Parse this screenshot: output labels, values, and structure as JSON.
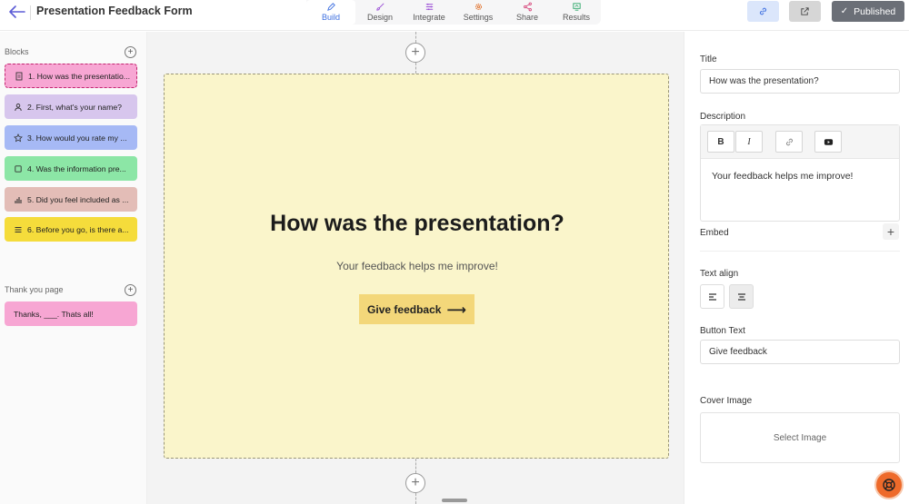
{
  "header": {
    "title": "Presentation Feedback Form",
    "tabs": [
      {
        "label": "Build",
        "icon": "pencil-icon",
        "color": "#3d6fe0"
      },
      {
        "label": "Design",
        "icon": "brush-icon",
        "color": "#9b4fd6"
      },
      {
        "label": "Integrate",
        "icon": "sliders-icon",
        "color": "#9b4fd6"
      },
      {
        "label": "Settings",
        "icon": "gear-icon",
        "color": "#e0702a"
      },
      {
        "label": "Share",
        "icon": "share-icon",
        "color": "#d6457a"
      },
      {
        "label": "Results",
        "icon": "chart-icon",
        "color": "#2fa86a"
      }
    ],
    "published_label": "Published"
  },
  "sidebar": {
    "blocks_label": "Blocks",
    "blocks": [
      {
        "label": "1. How was the presentatio...",
        "icon": "document-icon",
        "color": "#f7a6d3"
      },
      {
        "label": "2. First, what's your name?",
        "icon": "user-icon",
        "color": "#d7c6ed"
      },
      {
        "label": "3. How would you rate my ...",
        "icon": "star-icon",
        "color": "#a6b9f5"
      },
      {
        "label": "4. Was the information pre...",
        "icon": "square-icon",
        "color": "#8ce6a6"
      },
      {
        "label": "5. Did you feel included as ...",
        "icon": "bar-chart-icon",
        "color": "#e3bdb7"
      },
      {
        "label": "6. Before you go, is there a...",
        "icon": "list-icon",
        "color": "#f5dc3b"
      }
    ],
    "thankyou_label": "Thank you page",
    "thankyou_item": {
      "label": "Thanks, ___. Thats all!",
      "color": "#f7a6d3"
    }
  },
  "canvas": {
    "title": "How was the presentation?",
    "description": "Your feedback helps me improve!",
    "button_label": "Give feedback",
    "card_color": "#faf5cb",
    "button_color": "#f3d77a"
  },
  "panel": {
    "title_label": "Title",
    "title_value": "How was the presentation?",
    "description_label": "Description",
    "description_value": "Your feedback helps me improve!",
    "embed_label": "Embed",
    "text_align_label": "Text align",
    "button_text_label": "Button Text",
    "button_text_value": "Give feedback",
    "cover_image_label": "Cover Image",
    "select_image_label": "Select Image"
  }
}
